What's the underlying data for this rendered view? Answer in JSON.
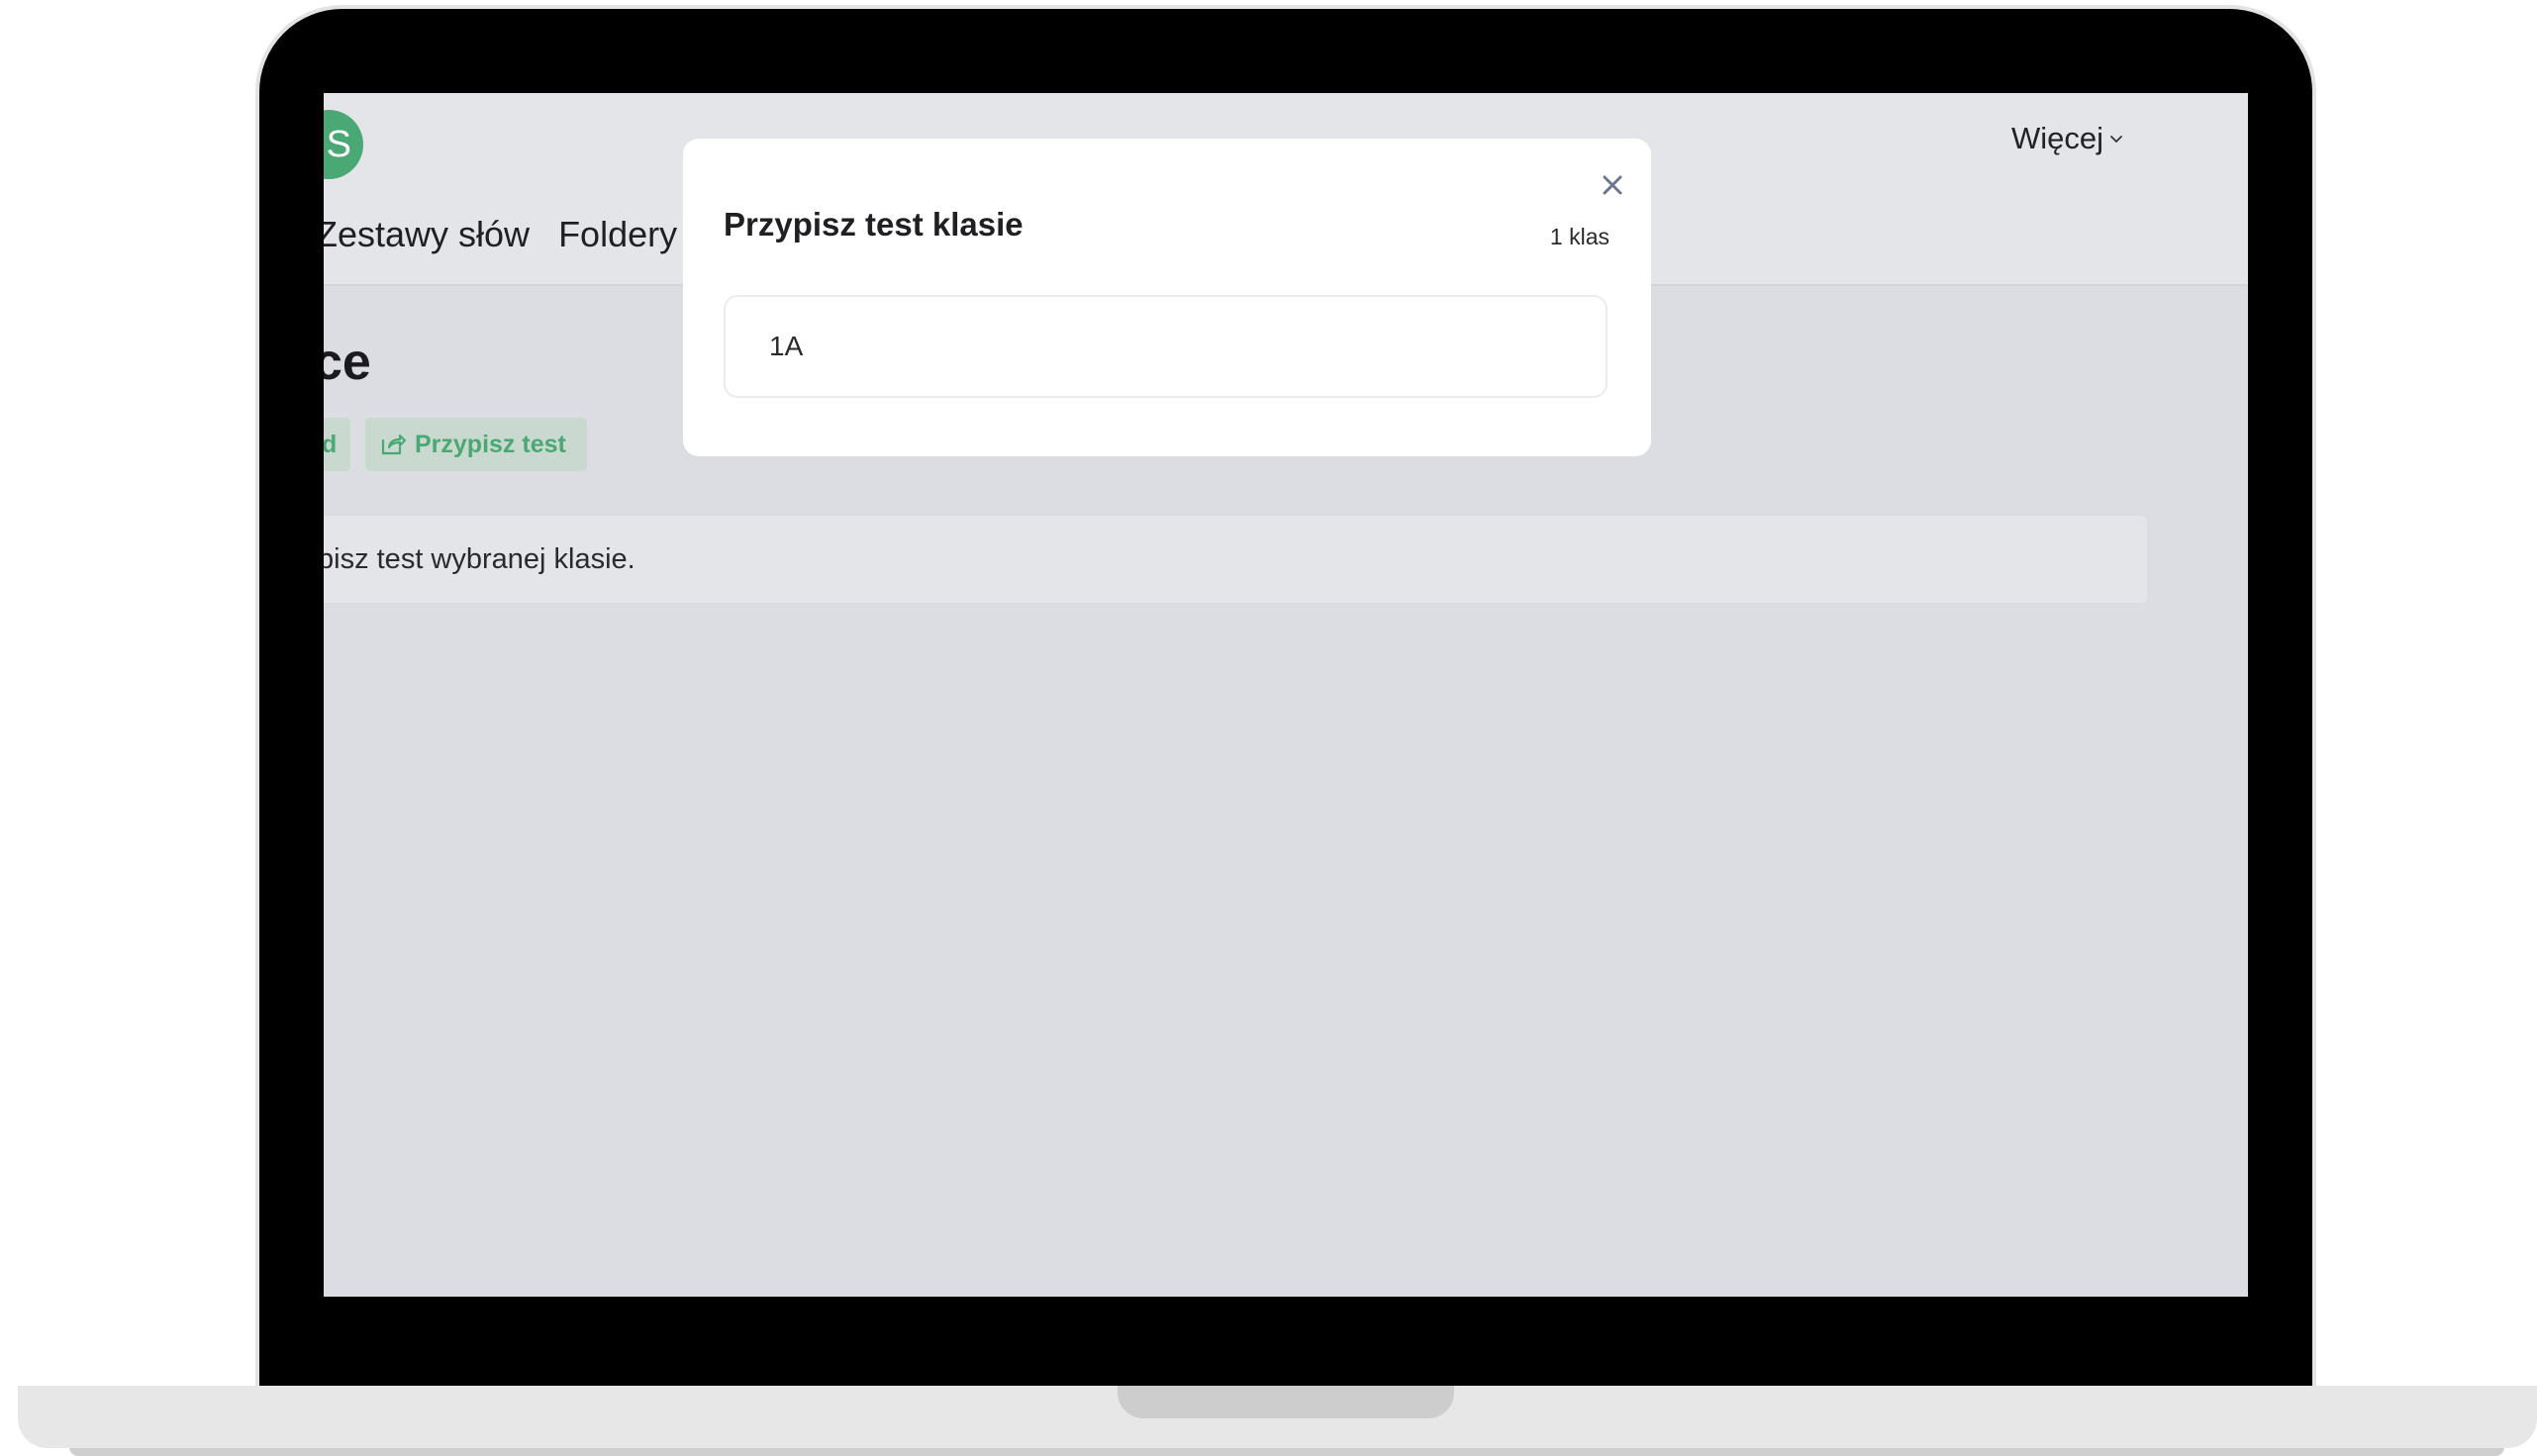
{
  "header": {
    "logo_letter": "S",
    "nav": [
      {
        "label": "Zestawy słów"
      },
      {
        "label": "Foldery"
      }
    ],
    "more_label": "Więcej"
  },
  "page": {
    "title_fragment": "ce",
    "chip_left_label": "d",
    "assign_button_label": "Przypisz test",
    "info_text": "pisz test wybranej klasie."
  },
  "modal": {
    "title": "Przypisz test klasie",
    "count_label": "1 klas",
    "classes": [
      {
        "name": "1A"
      }
    ]
  },
  "colors": {
    "accent": "#4aa874",
    "backdrop": "#dcdde2",
    "chip_bg": "#c9d9d0",
    "close_icon": "#6b7690"
  },
  "icons": {
    "close": "close-icon",
    "share": "share-icon",
    "chevron": "chevron-down-icon"
  }
}
